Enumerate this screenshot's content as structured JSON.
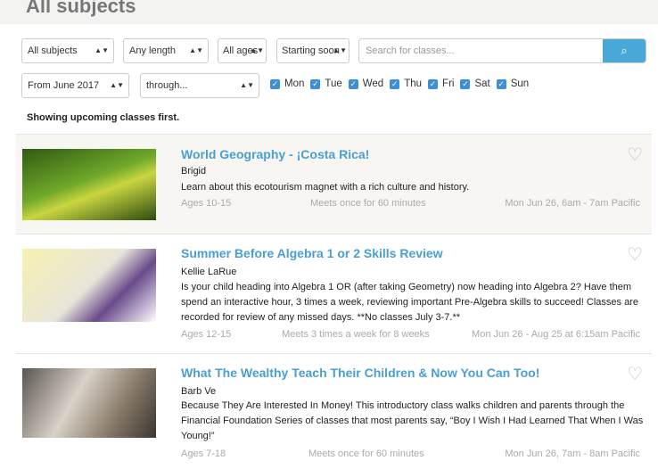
{
  "header": {
    "title": "All subjects"
  },
  "filters": {
    "subject": "All subjects",
    "length": "Any length",
    "ages": "All ages",
    "sort": "Starting soon",
    "from": "From June 2017",
    "through": "through...",
    "search_placeholder": "Search for classes...",
    "days": [
      {
        "label": "Mon",
        "checked": true
      },
      {
        "label": "Tue",
        "checked": true
      },
      {
        "label": "Wed",
        "checked": true
      },
      {
        "label": "Thu",
        "checked": true
      },
      {
        "label": "Fri",
        "checked": true
      },
      {
        "label": "Sat",
        "checked": true
      },
      {
        "label": "Sun",
        "checked": true
      }
    ]
  },
  "note": "Showing upcoming classes first.",
  "classes": [
    {
      "title": "World Geography - ¡Costa Rica!",
      "teacher": "Brigid",
      "description": "Learn about this ecotourism magnet with a rich culture and history.",
      "ages": "Ages 10-15",
      "meets": "Meets once for 60 minutes",
      "when": "Mon Jun 26, 6am - 7am Pacific"
    },
    {
      "title": "Summer Before Algebra 1 or 2 Skills Review",
      "teacher": "Kellie LaRue",
      "description": "Is your child heading into Algebra 1 OR (after taking Geometry) now heading into Algebra 2? Have them spend an interactive hour, 3 times a week, reviewing important Pre-Algebra skills to succeed! Classes are recorded for review of any missed days. **No classes July 3-7.**",
      "ages": "Ages 12-15",
      "meets": "Meets 3 times a week for 8 weeks",
      "when": "Mon Jun 26 - Aug 25 at 6:15am Pacific"
    },
    {
      "title": "What The Wealthy Teach Their Children & Now You Can Too!",
      "teacher": "Barb Ve",
      "description": "Because They Are Interested In Money! This introductory class walks children and parents through the Financial Foundation Series of classes that most parents say, “Boy I Wish I Had Learned That When I Was Young!”",
      "ages": "Ages 7-18",
      "meets": "Meets once for 60 minutes",
      "when": "Mon Jun 26, 7am - 8am Pacific"
    }
  ]
}
